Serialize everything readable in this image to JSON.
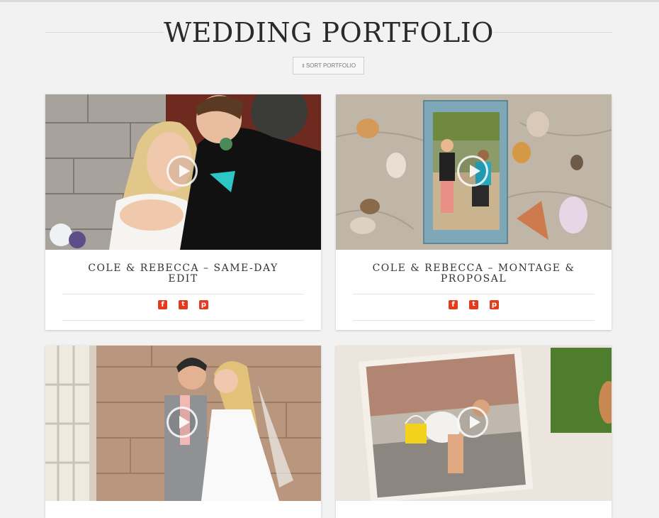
{
  "page": {
    "title": "WEDDING PORTFOLIO",
    "sort_button": "SORT PORTFOLIO",
    "sort_icon": "sort-icon"
  },
  "colors": {
    "background": "#f2f2f2",
    "social_icon": "#e33b1e",
    "title_text": "#2a2a2a"
  },
  "portfolio": {
    "items": [
      {
        "title": "COLE & REBECCA – SAME-DAY EDIT",
        "thumbnail": "bride and groom embracing beside stone wall",
        "social": [
          "facebook-icon",
          "twitter-icon",
          "pinterest-icon"
        ]
      },
      {
        "title": "COLE & REBECCA – MONTAGE & PROPOSAL",
        "thumbnail": "framed proposal photo on sand with seashells",
        "social": [
          "facebook-icon",
          "twitter-icon",
          "pinterest-icon"
        ]
      },
      {
        "title": "",
        "thumbnail": "couple posing by stone wall and white door"
      },
      {
        "title": "",
        "thumbnail": "photo montage of child playing on beach"
      }
    ]
  }
}
